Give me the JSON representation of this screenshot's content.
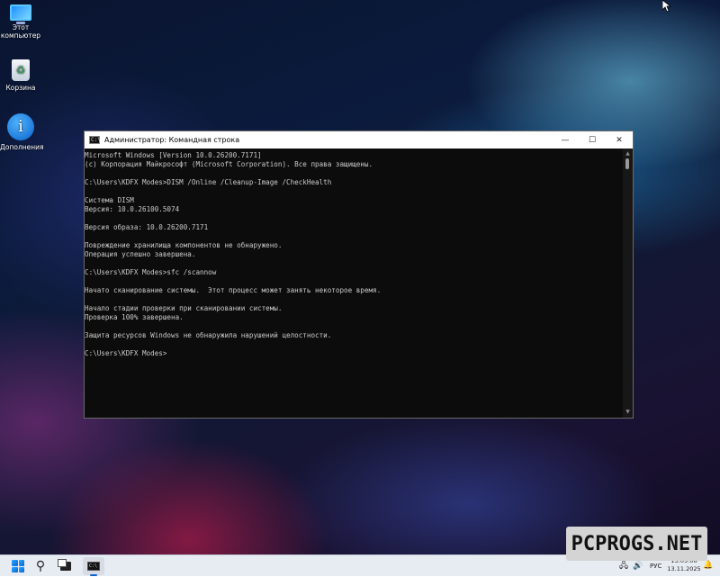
{
  "desktop": {
    "icons": [
      {
        "label_line1": "Этот",
        "label_line2": "компьютер",
        "icon": "this-pc-icon"
      },
      {
        "label": "Корзина",
        "icon": "recycle-bin-icon"
      },
      {
        "label": "Дополнения",
        "icon": "info-icon",
        "glyph": "i"
      }
    ]
  },
  "window": {
    "title": "Администратор: Командная строка",
    "app_icon_glyph": "C:\\",
    "controls": {
      "minimize": "—",
      "maximize": "☐",
      "close": "✕"
    },
    "console_lines": [
      "Microsoft Windows [Version 10.0.26200.7171]",
      "(c) Корпорация Майкрософт (Microsoft Corporation). Все права защищены.",
      "",
      "C:\\Users\\KDFX Modes>DISM /Online /Cleanup-Image /CheckHealth",
      "",
      "Система DISM",
      "Версия: 10.0.26100.5074",
      "",
      "Версия образа: 10.0.26200.7171",
      "",
      "Повреждение хранилища компонентов не обнаружено.",
      "Операция успешно завершена.",
      "",
      "C:\\Users\\KDFX Modes>sfc /scannow",
      "",
      "Начато сканирование системы.  Этот процесс может занять некоторое время.",
      "",
      "Начало стадии проверки при сканировании системы.",
      "Проверка 100% завершена.",
      "",
      "Защита ресурсов Windows не обнаружила нарушений целостности.",
      "",
      "C:\\Users\\KDFX Modes>"
    ],
    "scrollbar": {
      "up": "▲",
      "down": "▼"
    }
  },
  "taskbar": {
    "search_glyph": "⚲",
    "cmd_glyph": "C:\\",
    "tray": {
      "network_glyph": "🖧",
      "volume_glyph": "🔊",
      "language": "РУС",
      "time": "13:05:06",
      "date": "13.11.2025",
      "bell_glyph": "🔔"
    }
  },
  "watermark": {
    "text": "PCPROGS.NET"
  },
  "colors": {
    "console_bg": "#0c0c0c",
    "console_text": "#cccccc",
    "taskbar_bg": "#e7ebf2",
    "accent": "#0b63d1"
  }
}
